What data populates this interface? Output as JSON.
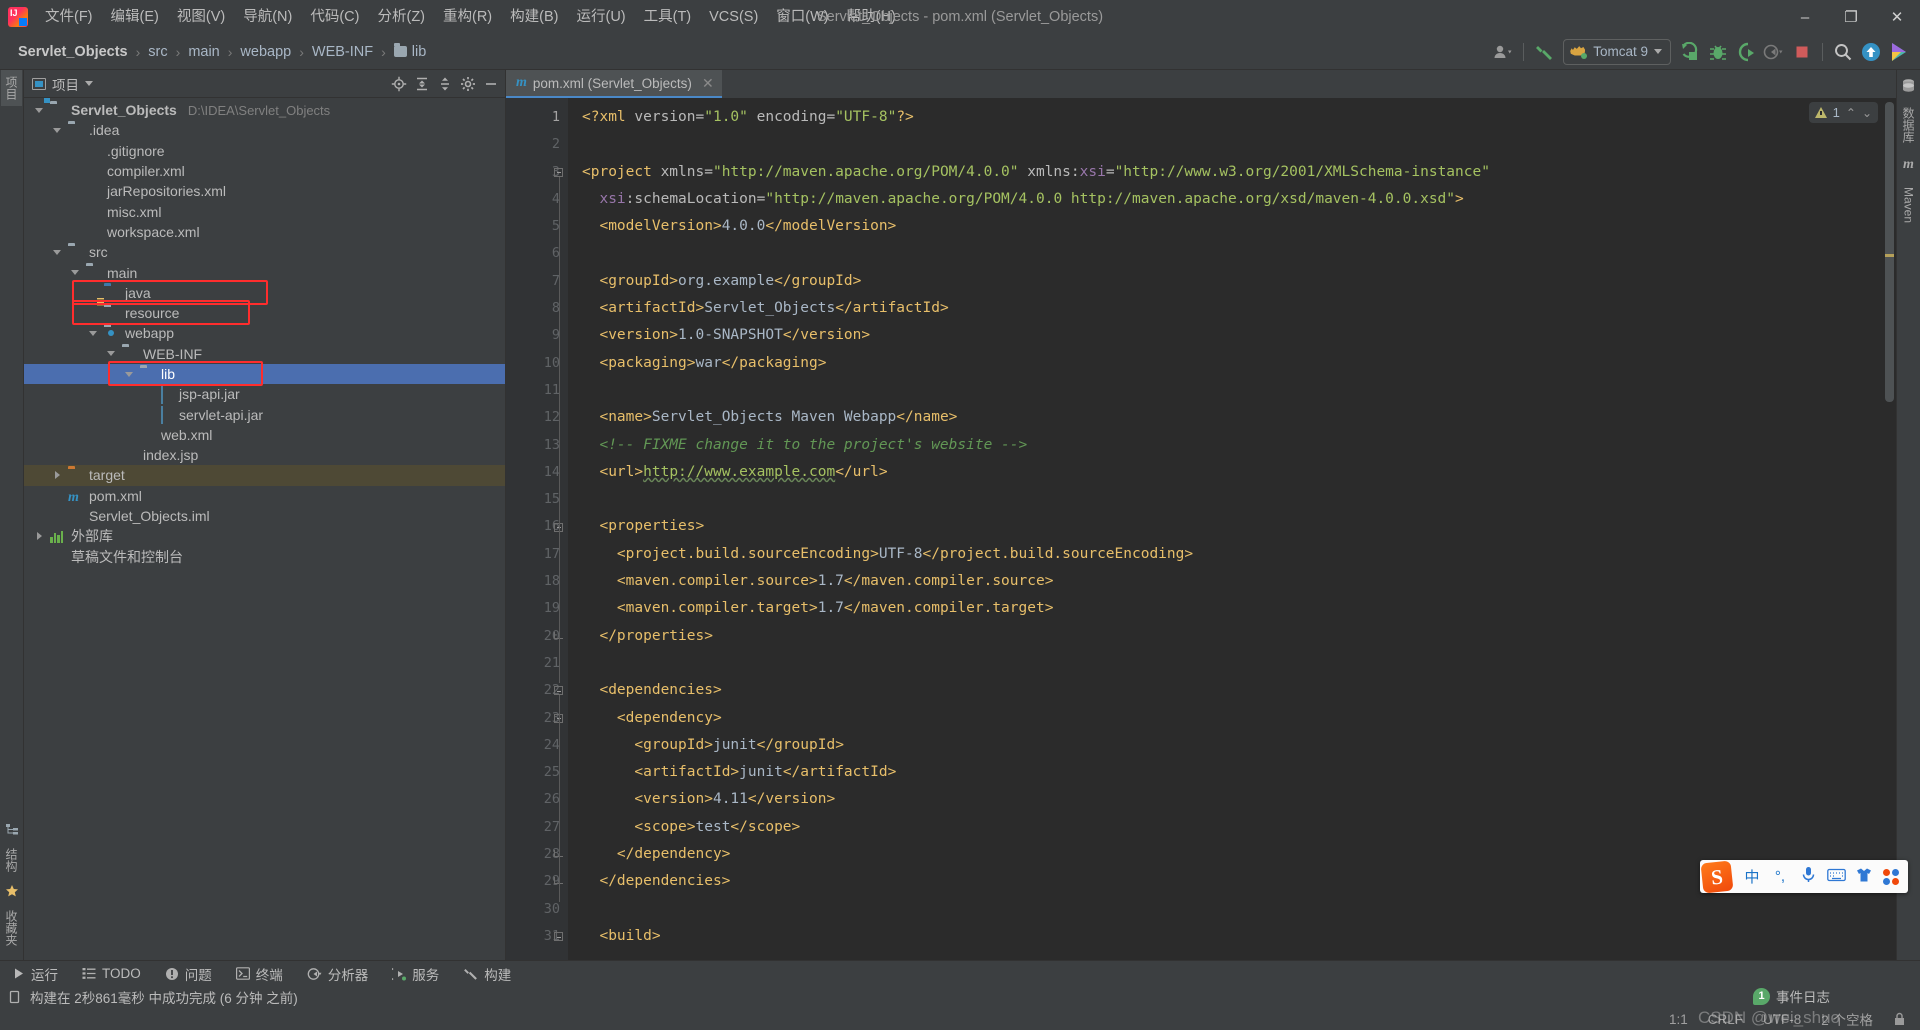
{
  "window": {
    "title": "Servlet_Objects - pom.xml (Servlet_Objects)",
    "minimize": "–",
    "maximize": "❐",
    "close": "✕"
  },
  "menubar": [
    {
      "label": "文件(F)"
    },
    {
      "label": "编辑(E)"
    },
    {
      "label": "视图(V)"
    },
    {
      "label": "导航(N)"
    },
    {
      "label": "代码(C)"
    },
    {
      "label": "分析(Z)"
    },
    {
      "label": "重构(R)"
    },
    {
      "label": "构建(B)"
    },
    {
      "label": "运行(U)"
    },
    {
      "label": "工具(T)"
    },
    {
      "label": "VCS(S)"
    },
    {
      "label": "窗口(W)"
    },
    {
      "label": "帮助(H)"
    }
  ],
  "breadcrumb": {
    "items": [
      "Servlet_Objects",
      "src",
      "main",
      "webapp",
      "WEB-INF",
      "lib"
    ],
    "separator": "›"
  },
  "toolbar": {
    "run_config": "Tomcat 9",
    "icons": [
      "user-avatar-icon",
      "build-hammer-icon",
      "run-icon",
      "debug-icon",
      "run-with-coverage-icon",
      "profiler-icon",
      "stop-icon",
      "search-everywhere-icon",
      "update-project-icon",
      "idea-feature-icon"
    ]
  },
  "project_panel": {
    "title": "项目",
    "header_buttons": [
      "locate-icon",
      "expand-all-icon",
      "collapse-all-icon",
      "settings-gear-icon",
      "hide-icon"
    ],
    "tree": [
      {
        "indent": 0,
        "arrow": "down",
        "icon": "mod",
        "label": "Servlet_Objects",
        "bold": true,
        "path": "D:\\IDEA\\Servlet_Objects"
      },
      {
        "indent": 1,
        "arrow": "down",
        "icon": "folder",
        "label": ".idea"
      },
      {
        "indent": 2,
        "arrow": "none",
        "icon": "gitignore",
        "label": ".gitignore"
      },
      {
        "indent": 2,
        "arrow": "none",
        "icon": "xml",
        "label": "compiler.xml"
      },
      {
        "indent": 2,
        "arrow": "none",
        "icon": "xml",
        "label": "jarRepositories.xml"
      },
      {
        "indent": 2,
        "arrow": "none",
        "icon": "xml",
        "label": "misc.xml"
      },
      {
        "indent": 2,
        "arrow": "none",
        "icon": "xml",
        "label": "workspace.xml"
      },
      {
        "indent": 1,
        "arrow": "down",
        "icon": "folder",
        "label": "src"
      },
      {
        "indent": 2,
        "arrow": "down",
        "icon": "folder",
        "label": "main"
      },
      {
        "indent": 3,
        "arrow": "none",
        "icon": "srcfolder",
        "label": "java",
        "annotated": true
      },
      {
        "indent": 3,
        "arrow": "none",
        "icon": "resfolder",
        "label": "resource",
        "annotated": true
      },
      {
        "indent": 3,
        "arrow": "down",
        "icon": "webfolder",
        "label": "webapp"
      },
      {
        "indent": 4,
        "arrow": "down",
        "icon": "folder",
        "label": "WEB-INF"
      },
      {
        "indent": 5,
        "arrow": "down",
        "icon": "folder",
        "label": "lib",
        "selected": true,
        "annotated": true
      },
      {
        "indent": 6,
        "arrow": "none",
        "icon": "jar",
        "label": "jsp-api.jar"
      },
      {
        "indent": 6,
        "arrow": "none",
        "icon": "jar",
        "label": "servlet-api.jar"
      },
      {
        "indent": 5,
        "arrow": "none",
        "icon": "webxml",
        "label": "web.xml"
      },
      {
        "indent": 4,
        "arrow": "none",
        "icon": "jsp",
        "label": "index.jsp"
      },
      {
        "indent": 1,
        "arrow": "right",
        "icon": "tgtfolder",
        "label": "target",
        "highlight": true
      },
      {
        "indent": 1,
        "arrow": "none",
        "icon": "mvn",
        "label": "pom.xml"
      },
      {
        "indent": 1,
        "arrow": "none",
        "icon": "iml",
        "label": "Servlet_Objects.iml"
      },
      {
        "indent": 0,
        "arrow": "right",
        "icon": "libs",
        "label": "外部库"
      },
      {
        "indent": 0,
        "arrow": "none",
        "icon": "scratch",
        "label": "草稿文件和控制台"
      }
    ]
  },
  "left_strip": {
    "top": [
      "项目",
      "结构",
      "收藏夹"
    ],
    "bottom": [
      "结构",
      "收藏夹"
    ]
  },
  "right_strip": [
    "数据库",
    "Maven"
  ],
  "editor": {
    "tab": {
      "label": "pom.xml (Servlet_Objects)",
      "icon": "maven-m-icon",
      "close": "✕"
    },
    "inspection": {
      "count": "1",
      "up": "⌃",
      "down": "⌄"
    },
    "lines": [
      {
        "n": 1,
        "tokens": [
          {
            "t": "tag",
            "v": "<?xml "
          },
          {
            "t": "attr",
            "v": "version="
          },
          {
            "t": "val",
            "v": "\"1.0\""
          },
          {
            "t": "attr",
            "v": " encoding="
          },
          {
            "t": "val",
            "v": "\"UTF-8\""
          },
          {
            "t": "tag",
            "v": "?>"
          }
        ]
      },
      {
        "n": 2,
        "tokens": []
      },
      {
        "n": 3,
        "fold": "open",
        "tokens": [
          {
            "t": "tag",
            "v": "<project "
          },
          {
            "t": "attr",
            "v": "xmlns="
          },
          {
            "t": "val",
            "v": "\"http://maven.apache.org/POM/4.0.0\""
          },
          {
            "t": "attr",
            "v": " xmlns:"
          },
          {
            "t": "aname",
            "v": "xsi"
          },
          {
            "t": "attr",
            "v": "="
          },
          {
            "t": "val",
            "v": "\"http://www.w3.org/2001/XMLSchema-instance\""
          }
        ]
      },
      {
        "n": 4,
        "tokens": [
          {
            "t": "sp",
            "v": "  "
          },
          {
            "t": "aname",
            "v": "xsi"
          },
          {
            "t": "attr",
            "v": ":schemaLocation="
          },
          {
            "t": "val",
            "v": "\"http://maven.apache.org/POM/4.0.0 http://maven.apache.org/xsd/maven-4.0.0.xsd\""
          },
          {
            "t": "tag",
            "v": ">"
          }
        ]
      },
      {
        "n": 5,
        "tokens": [
          {
            "t": "sp",
            "v": "  "
          },
          {
            "t": "tag",
            "v": "<modelVersion>"
          },
          {
            "t": "txt",
            "v": "4.0.0"
          },
          {
            "t": "tag",
            "v": "</modelVersion>"
          }
        ]
      },
      {
        "n": 6,
        "tokens": []
      },
      {
        "n": 7,
        "tokens": [
          {
            "t": "sp",
            "v": "  "
          },
          {
            "t": "tag",
            "v": "<groupId>"
          },
          {
            "t": "txt",
            "v": "org.example"
          },
          {
            "t": "tag",
            "v": "</groupId>"
          }
        ]
      },
      {
        "n": 8,
        "tokens": [
          {
            "t": "sp",
            "v": "  "
          },
          {
            "t": "tag",
            "v": "<artifactId>"
          },
          {
            "t": "txt",
            "v": "Servlet_Objects"
          },
          {
            "t": "tag",
            "v": "</artifactId>"
          }
        ]
      },
      {
        "n": 9,
        "tokens": [
          {
            "t": "sp",
            "v": "  "
          },
          {
            "t": "tag",
            "v": "<version>"
          },
          {
            "t": "txt",
            "v": "1.0-SNAPSHOT"
          },
          {
            "t": "tag",
            "v": "</version>"
          }
        ]
      },
      {
        "n": 10,
        "tokens": [
          {
            "t": "sp",
            "v": "  "
          },
          {
            "t": "tag",
            "v": "<packaging>"
          },
          {
            "t": "txt",
            "v": "war"
          },
          {
            "t": "tag",
            "v": "</packaging>"
          }
        ]
      },
      {
        "n": 11,
        "tokens": []
      },
      {
        "n": 12,
        "tokens": [
          {
            "t": "sp",
            "v": "  "
          },
          {
            "t": "tag",
            "v": "<name>"
          },
          {
            "t": "txt",
            "v": "Servlet_Objects Maven Webapp"
          },
          {
            "t": "tag",
            "v": "</name>"
          }
        ]
      },
      {
        "n": 13,
        "tokens": [
          {
            "t": "sp",
            "v": "  "
          },
          {
            "t": "cmt",
            "v": "<!-- FIXME change it to the project's website -->"
          }
        ]
      },
      {
        "n": 14,
        "tokens": [
          {
            "t": "sp",
            "v": "  "
          },
          {
            "t": "tag",
            "v": "<url>"
          },
          {
            "t": "lnk",
            "v": "http://www.example.com"
          },
          {
            "t": "tag",
            "v": "</url>"
          }
        ]
      },
      {
        "n": 15,
        "tokens": []
      },
      {
        "n": 16,
        "fold": "open",
        "tokens": [
          {
            "t": "sp",
            "v": "  "
          },
          {
            "t": "tag",
            "v": "<properties>"
          }
        ]
      },
      {
        "n": 17,
        "tokens": [
          {
            "t": "sp",
            "v": "    "
          },
          {
            "t": "tag",
            "v": "<project.build.sourceEncoding>"
          },
          {
            "t": "txt",
            "v": "UTF-8"
          },
          {
            "t": "tag",
            "v": "</project.build.sourceEncoding>"
          }
        ]
      },
      {
        "n": 18,
        "tokens": [
          {
            "t": "sp",
            "v": "    "
          },
          {
            "t": "tag",
            "v": "<maven.compiler.source>"
          },
          {
            "t": "txt",
            "v": "1.7"
          },
          {
            "t": "tag",
            "v": "</maven.compiler.source>"
          }
        ]
      },
      {
        "n": 19,
        "tokens": [
          {
            "t": "sp",
            "v": "    "
          },
          {
            "t": "tag",
            "v": "<maven.compiler.target>"
          },
          {
            "t": "txt",
            "v": "1.7"
          },
          {
            "t": "tag",
            "v": "</maven.compiler.target>"
          }
        ]
      },
      {
        "n": 20,
        "fold": "end",
        "tokens": [
          {
            "t": "sp",
            "v": "  "
          },
          {
            "t": "tag",
            "v": "</properties>"
          }
        ]
      },
      {
        "n": 21,
        "tokens": []
      },
      {
        "n": 22,
        "fold": "open",
        "tokens": [
          {
            "t": "sp",
            "v": "  "
          },
          {
            "t": "tag",
            "v": "<dependencies>"
          }
        ]
      },
      {
        "n": 23,
        "fold": "open",
        "tokens": [
          {
            "t": "sp",
            "v": "    "
          },
          {
            "t": "tag",
            "v": "<dependency>"
          }
        ]
      },
      {
        "n": 24,
        "tokens": [
          {
            "t": "sp",
            "v": "      "
          },
          {
            "t": "tag",
            "v": "<groupId>"
          },
          {
            "t": "txt",
            "v": "junit"
          },
          {
            "t": "tag",
            "v": "</groupId>"
          }
        ]
      },
      {
        "n": 25,
        "tokens": [
          {
            "t": "sp",
            "v": "      "
          },
          {
            "t": "tag",
            "v": "<artifactId>"
          },
          {
            "t": "txt",
            "v": "junit"
          },
          {
            "t": "tag",
            "v": "</artifactId>"
          }
        ]
      },
      {
        "n": 26,
        "tokens": [
          {
            "t": "sp",
            "v": "      "
          },
          {
            "t": "tag",
            "v": "<version>"
          },
          {
            "t": "txt",
            "v": "4.11"
          },
          {
            "t": "tag",
            "v": "</version>"
          }
        ]
      },
      {
        "n": 27,
        "tokens": [
          {
            "t": "sp",
            "v": "      "
          },
          {
            "t": "tag",
            "v": "<scope>"
          },
          {
            "t": "txt",
            "v": "test"
          },
          {
            "t": "tag",
            "v": "</scope>"
          }
        ]
      },
      {
        "n": 28,
        "fold": "end",
        "tokens": [
          {
            "t": "sp",
            "v": "    "
          },
          {
            "t": "tag",
            "v": "</dependency>"
          }
        ]
      },
      {
        "n": 29,
        "fold": "end",
        "tokens": [
          {
            "t": "sp",
            "v": "  "
          },
          {
            "t": "tag",
            "v": "</dependencies>"
          }
        ]
      },
      {
        "n": 30,
        "tokens": []
      },
      {
        "n": 31,
        "fold": "open",
        "tokens": [
          {
            "t": "sp",
            "v": "  "
          },
          {
            "t": "tag",
            "v": "<build>"
          }
        ]
      }
    ]
  },
  "bottom_toolwindows": [
    {
      "label": "运行",
      "icon": "run-triangle-icon"
    },
    {
      "label": "TODO",
      "icon": "todo-list-icon"
    },
    {
      "label": "问题",
      "icon": "problems-icon"
    },
    {
      "label": "终端",
      "icon": "terminal-icon"
    },
    {
      "label": "分析器",
      "icon": "profiler-icon"
    },
    {
      "label": "服务",
      "icon": "services-icon"
    },
    {
      "label": "构建",
      "icon": "build-hammer-icon"
    }
  ],
  "status": {
    "build_message": "构建在 2秒861毫秒 中成功完成 (6 分钟 之前)",
    "event_log": {
      "label": "事件日志",
      "count": "1"
    },
    "caret": "1:1",
    "line_sep": "CRLF",
    "encoding": "UTF-8",
    "indent": "2 个空格",
    "lock_icon": "lock-icon"
  },
  "ime": {
    "brand": "S",
    "mode": "中",
    "punct": "°,",
    "items": [
      "voice-input-icon",
      "soft-keyboard-icon",
      "skin-icon",
      "toolbox-icon"
    ]
  },
  "watermark": "CSDN @wei_shuo",
  "colors": {
    "accent_blue": "#4b6eaf",
    "annotation_red": "#ff2d2d",
    "editor_bg": "#2b2b2b",
    "panel_bg": "#3c3f41",
    "tag": "#e8bf6a",
    "value": "#a5c261",
    "comment": "#629755",
    "text": "#a9b7c6"
  }
}
